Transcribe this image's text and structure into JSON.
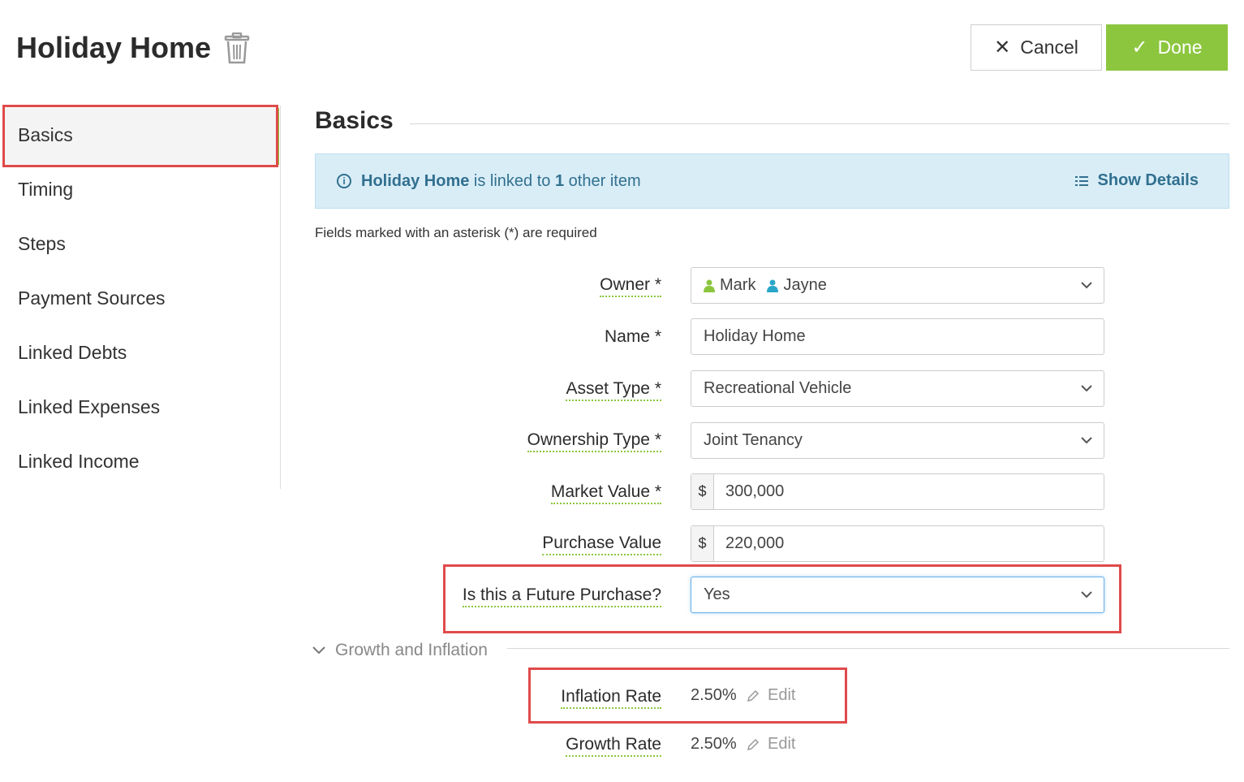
{
  "header": {
    "title": "Holiday Home",
    "delete_icon": "trash-icon",
    "cancel_label": "Cancel",
    "done_label": "Done",
    "done_color": "#8cc63f"
  },
  "sidebar": {
    "items": [
      {
        "label": "Basics",
        "active": true
      },
      {
        "label": "Timing"
      },
      {
        "label": "Steps"
      },
      {
        "label": "Payment Sources"
      },
      {
        "label": "Linked Debts"
      },
      {
        "label": "Linked Expenses"
      },
      {
        "label": "Linked Income"
      }
    ]
  },
  "main": {
    "section_title": "Basics",
    "info": {
      "item_name": "Holiday Home",
      "text_mid": "is linked to",
      "count": "1",
      "text_end": "other item",
      "show_details": "Show Details"
    },
    "required_note": "Fields marked with an asterisk (*) are required",
    "fields": {
      "owner": {
        "label": "Owner *",
        "values": [
          "Mark",
          "Jayne"
        ]
      },
      "name": {
        "label": "Name *",
        "value": "Holiday Home"
      },
      "asset_type": {
        "label": "Asset Type *",
        "value": "Recreational Vehicle"
      },
      "ownership_type": {
        "label": "Ownership Type *",
        "value": "Joint Tenancy"
      },
      "market_value": {
        "label": "Market Value *",
        "currency": "$",
        "value": "300,000"
      },
      "purchase_value": {
        "label": "Purchase Value",
        "currency": "$",
        "value": "220,000"
      },
      "future_purchase": {
        "label": "Is this a Future Purchase?",
        "value": "Yes"
      }
    },
    "growth": {
      "title": "Growth and Inflation",
      "inflation": {
        "label": "Inflation Rate",
        "value": "2.50%",
        "edit": "Edit"
      },
      "growth_rate": {
        "label": "Growth Rate",
        "value": "2.50%",
        "edit": "Edit"
      }
    }
  }
}
